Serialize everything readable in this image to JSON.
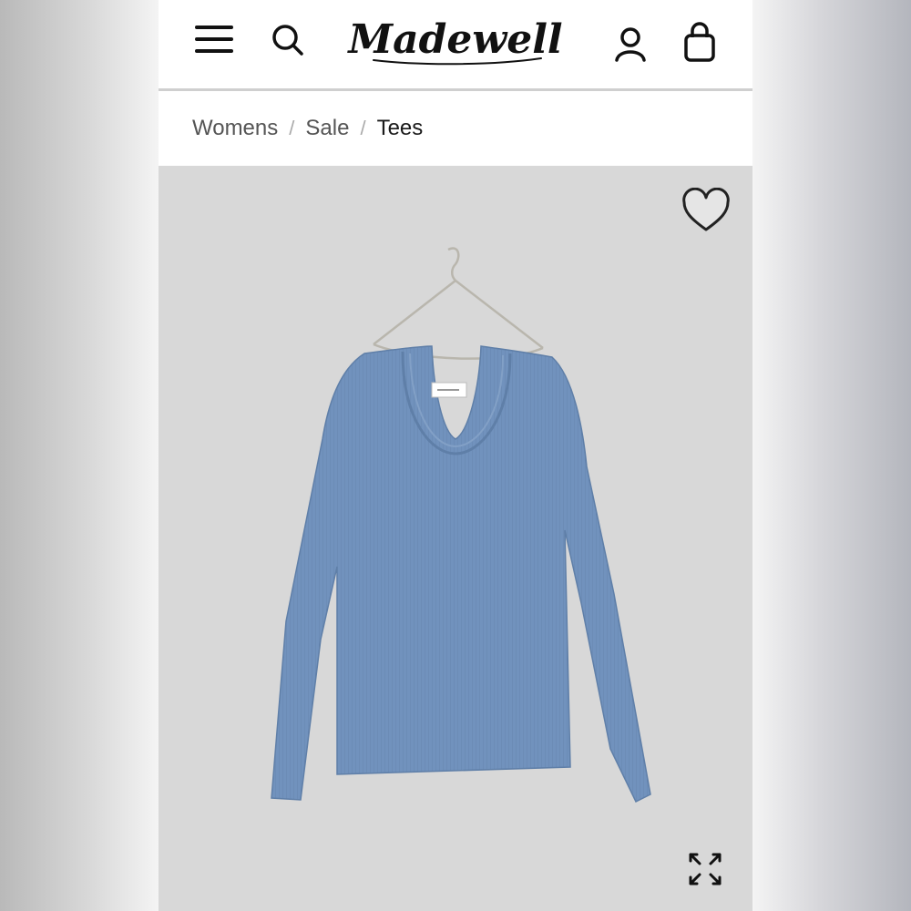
{
  "header": {
    "brand": "Madewell",
    "icons": [
      "menu-icon",
      "search-icon",
      "account-icon",
      "shopping-bag-icon"
    ]
  },
  "breadcrumb": {
    "items": [
      {
        "label": "Womens"
      },
      {
        "label": "Sale"
      },
      {
        "label": "Tees"
      }
    ],
    "separator": "/"
  },
  "product": {
    "image_subject": "blue long-sleeve scoop-neck tee on hanger",
    "garment_color": "#6f8fb8",
    "background_color": "#d8d8d8",
    "favorite_icon": "heart-icon",
    "expand_icon": "expand-icon"
  }
}
